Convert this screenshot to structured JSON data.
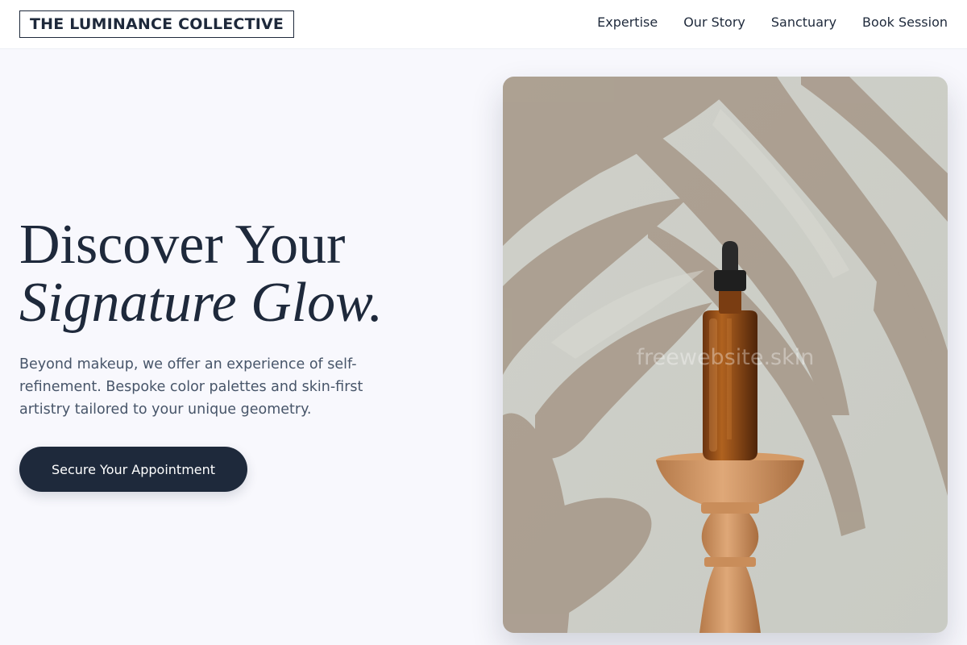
{
  "brand": {
    "name": "THE LUMINANCE COLLECTIVE"
  },
  "nav": {
    "items": [
      {
        "label": "Expertise"
      },
      {
        "label": "Our Story"
      },
      {
        "label": "Sanctuary"
      },
      {
        "label": "Book Session"
      }
    ]
  },
  "hero": {
    "title_line1": "Discover Your",
    "title_line2": "Signature Glow.",
    "subtitle": "Beyond makeup, we offer an experience of self-refinement. Bespoke color palettes and skin-first artistry tailored to your unique geometry.",
    "cta_label": "Secure Your Appointment"
  },
  "photo": {
    "watermark": "freewebsite.skin",
    "subject": "amber dropper bottle on wooden pedestal with palm leaf shadows"
  },
  "colors": {
    "primary": "#1e293b",
    "background": "#f8f8fd",
    "text_muted": "#475569"
  }
}
